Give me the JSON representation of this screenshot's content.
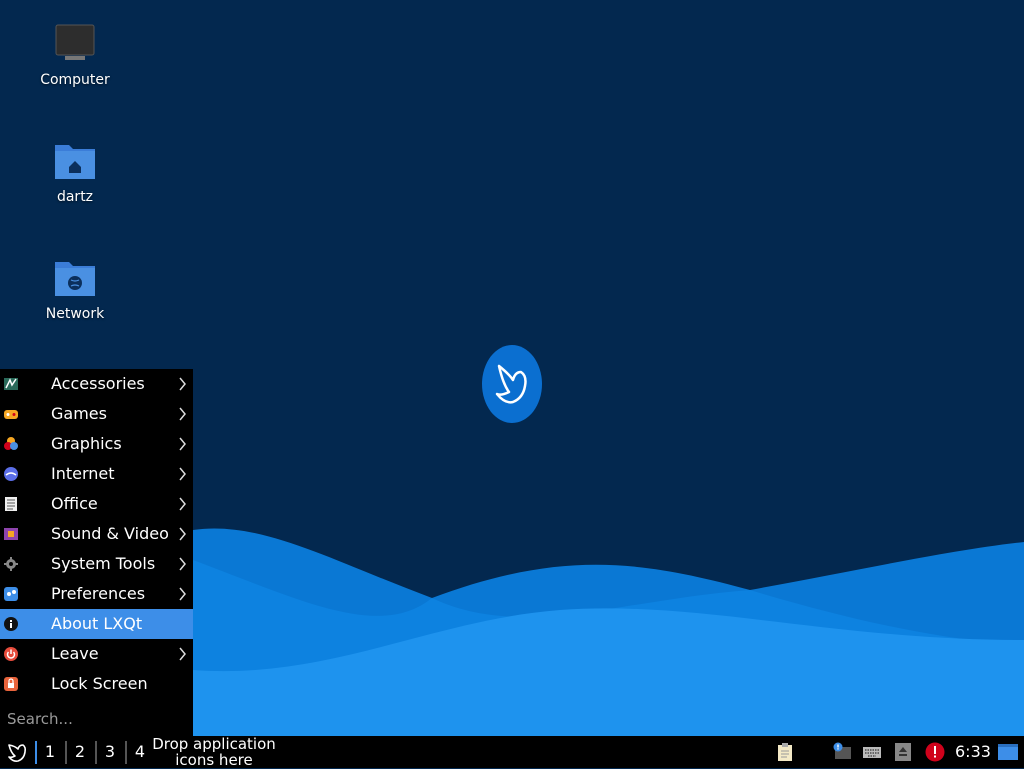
{
  "desktop": {
    "icons": [
      {
        "label": "Computer",
        "icon": "computer-icon"
      },
      {
        "label": "dartz",
        "icon": "home-folder-icon"
      },
      {
        "label": "Network",
        "icon": "network-folder-icon"
      }
    ]
  },
  "menu": {
    "items": [
      {
        "label": "Accessories",
        "icon": "accessories-icon",
        "submenu": true
      },
      {
        "label": "Games",
        "icon": "games-icon",
        "submenu": true
      },
      {
        "label": "Graphics",
        "icon": "graphics-icon",
        "submenu": true
      },
      {
        "label": "Internet",
        "icon": "internet-icon",
        "submenu": true
      },
      {
        "label": "Office",
        "icon": "office-icon",
        "submenu": true
      },
      {
        "label": "Sound & Video",
        "icon": "sound-video-icon",
        "submenu": true
      },
      {
        "label": "System Tools",
        "icon": "system-tools-icon",
        "submenu": true
      },
      {
        "label": "Preferences",
        "icon": "preferences-icon",
        "submenu": true
      },
      {
        "label": "About LXQt",
        "icon": "info-icon",
        "submenu": false,
        "active": true
      },
      {
        "label": "Leave",
        "icon": "power-icon",
        "submenu": true
      },
      {
        "label": "Lock Screen",
        "icon": "lock-icon",
        "submenu": false
      }
    ],
    "search": {
      "placeholder": "Search..."
    }
  },
  "taskbar": {
    "workspaces": [
      "1",
      "2",
      "3",
      "4"
    ],
    "active_workspace": "1",
    "drop_text_line1": "Drop application",
    "drop_text_line2": "icons here",
    "tray_icons": [
      "clipboard-icon",
      "notification-icon",
      "keyboard-icon",
      "eject-icon",
      "alert-icon",
      "show-desktop-icon"
    ],
    "clock": "6:33"
  },
  "colors": {
    "background": "#03284f",
    "accent": "#3d8ee8",
    "wave_light": "#1a8fe8",
    "menu_bg": "#000000"
  }
}
